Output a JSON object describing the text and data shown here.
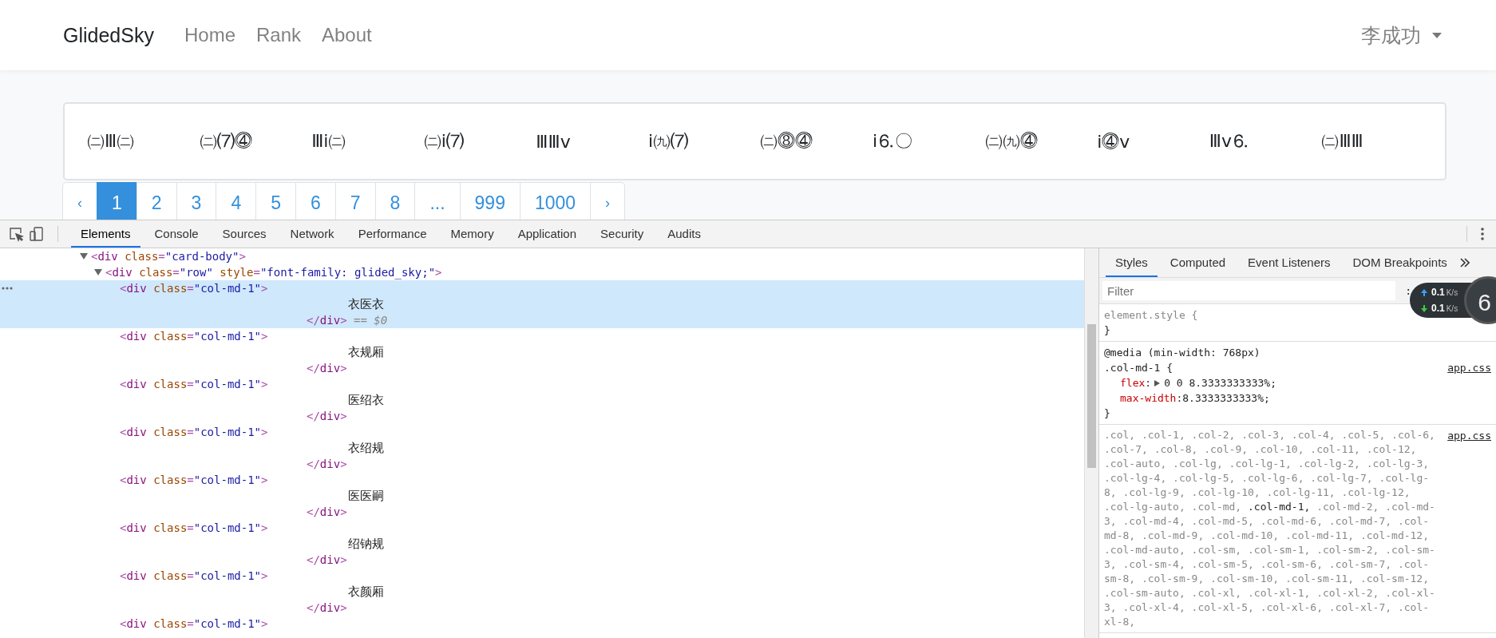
{
  "navbar": {
    "brand": "GlidedSky",
    "links": [
      {
        "label": "Home"
      },
      {
        "label": "Rank"
      },
      {
        "label": "About"
      }
    ],
    "user": "李成功"
  },
  "card": {
    "items": [
      "㈡Ⅲ㈡",
      "㈡⑺⓸",
      "Ⅲⅰ㈡",
      "㈡ⅰ⑺",
      "ⅢⅢⅴ",
      "ⅰ㈨⑺",
      "㈡⓼⓸",
      "ⅰ⒍〇",
      "㈡㈨⓸",
      "ⅰ⓸ⅴ",
      "Ⅲⅴ⒍",
      "㈡ⅢⅢ"
    ]
  },
  "pagination": [
    {
      "label": "‹",
      "selected": false
    },
    {
      "label": "1",
      "selected": true
    },
    {
      "label": "2",
      "selected": false
    },
    {
      "label": "3",
      "selected": false
    },
    {
      "label": "4",
      "selected": false
    },
    {
      "label": "5",
      "selected": false
    },
    {
      "label": "6",
      "selected": false
    },
    {
      "label": "7",
      "selected": false
    },
    {
      "label": "8",
      "selected": false
    },
    {
      "label": "...",
      "selected": false
    },
    {
      "label": "999",
      "selected": false
    },
    {
      "label": "1000",
      "selected": false
    },
    {
      "label": "›",
      "selected": false
    }
  ],
  "devtools": {
    "tabs": [
      {
        "label": "Elements",
        "selected": true
      },
      {
        "label": "Console",
        "selected": false
      },
      {
        "label": "Sources",
        "selected": false
      },
      {
        "label": "Network",
        "selected": false
      },
      {
        "label": "Performance",
        "selected": false
      },
      {
        "label": "Memory",
        "selected": false
      },
      {
        "label": "Application",
        "selected": false
      },
      {
        "label": "Security",
        "selected": false
      },
      {
        "label": "Audits",
        "selected": false
      }
    ],
    "dom_tree": [
      {
        "open": [
          {
            "kind": "punct",
            "text": "<"
          },
          {
            "kind": "tag",
            "text": "div"
          },
          {
            "kind": "attr",
            "text": " class"
          },
          {
            "kind": "punct",
            "text": "="
          },
          {
            "kind": "value",
            "text": "\"card-body\""
          },
          {
            "kind": "punct",
            "text": ">"
          }
        ],
        "expanded": true,
        "selected": false,
        "children": [
          {
            "open": [
              {
                "kind": "punct",
                "text": "<"
              },
              {
                "kind": "tag",
                "text": "div"
              },
              {
                "kind": "attr",
                "text": " class"
              },
              {
                "kind": "punct",
                "text": "="
              },
              {
                "kind": "value",
                "text": "\"row\""
              },
              {
                "kind": "attr",
                "text": " style"
              },
              {
                "kind": "punct",
                "text": "="
              },
              {
                "kind": "value",
                "text": "\"font-family: glided_sky;\""
              },
              {
                "kind": "punct",
                "text": ">"
              }
            ],
            "expanded": true,
            "selected": false,
            "children": [
              {
                "open": [
                  {
                    "kind": "punct",
                    "text": "<"
                  },
                  {
                    "kind": "tag",
                    "text": "div"
                  },
                  {
                    "kind": "attr",
                    "text": " class"
                  },
                  {
                    "kind": "punct",
                    "text": "="
                  },
                  {
                    "kind": "value",
                    "text": "\"col-md-1\""
                  },
                  {
                    "kind": "punct",
                    "text": ">"
                  }
                ],
                "text": "衣医衣",
                "close": [
                  {
                    "kind": "punct",
                    "text": "</"
                  },
                  {
                    "kind": "tag",
                    "text": "div"
                  },
                  {
                    "kind": "punct",
                    "text": ">"
                  },
                  {
                    "kind": "note",
                    "text": " == $0"
                  }
                ],
                "selected": true
              },
              {
                "open": [
                  {
                    "kind": "punct",
                    "text": "<"
                  },
                  {
                    "kind": "tag",
                    "text": "div"
                  },
                  {
                    "kind": "attr",
                    "text": " class"
                  },
                  {
                    "kind": "punct",
                    "text": "="
                  },
                  {
                    "kind": "value",
                    "text": "\"col-md-1\""
                  },
                  {
                    "kind": "punct",
                    "text": ">"
                  }
                ],
                "text": "衣规厢",
                "close": [
                  {
                    "kind": "punct",
                    "text": "</"
                  },
                  {
                    "kind": "tag",
                    "text": "div"
                  },
                  {
                    "kind": "punct",
                    "text": ">"
                  }
                ],
                "selected": false
              },
              {
                "open": [
                  {
                    "kind": "punct",
                    "text": "<"
                  },
                  {
                    "kind": "tag",
                    "text": "div"
                  },
                  {
                    "kind": "attr",
                    "text": " class"
                  },
                  {
                    "kind": "punct",
                    "text": "="
                  },
                  {
                    "kind": "value",
                    "text": "\"col-md-1\""
                  },
                  {
                    "kind": "punct",
                    "text": ">"
                  }
                ],
                "text": "医绍衣",
                "close": [
                  {
                    "kind": "punct",
                    "text": "</"
                  },
                  {
                    "kind": "tag",
                    "text": "div"
                  },
                  {
                    "kind": "punct",
                    "text": ">"
                  }
                ],
                "selected": false
              },
              {
                "open": [
                  {
                    "kind": "punct",
                    "text": "<"
                  },
                  {
                    "kind": "tag",
                    "text": "div"
                  },
                  {
                    "kind": "attr",
                    "text": " class"
                  },
                  {
                    "kind": "punct",
                    "text": "="
                  },
                  {
                    "kind": "value",
                    "text": "\"col-md-1\""
                  },
                  {
                    "kind": "punct",
                    "text": ">"
                  }
                ],
                "text": "衣绍规",
                "close": [
                  {
                    "kind": "punct",
                    "text": "</"
                  },
                  {
                    "kind": "tag",
                    "text": "div"
                  },
                  {
                    "kind": "punct",
                    "text": ">"
                  }
                ],
                "selected": false
              },
              {
                "open": [
                  {
                    "kind": "punct",
                    "text": "<"
                  },
                  {
                    "kind": "tag",
                    "text": "div"
                  },
                  {
                    "kind": "attr",
                    "text": " class"
                  },
                  {
                    "kind": "punct",
                    "text": "="
                  },
                  {
                    "kind": "value",
                    "text": "\"col-md-1\""
                  },
                  {
                    "kind": "punct",
                    "text": ">"
                  }
                ],
                "text": "医医嗣",
                "close": [
                  {
                    "kind": "punct",
                    "text": "</"
                  },
                  {
                    "kind": "tag",
                    "text": "div"
                  },
                  {
                    "kind": "punct",
                    "text": ">"
                  }
                ],
                "selected": false
              },
              {
                "open": [
                  {
                    "kind": "punct",
                    "text": "<"
                  },
                  {
                    "kind": "tag",
                    "text": "div"
                  },
                  {
                    "kind": "attr",
                    "text": " class"
                  },
                  {
                    "kind": "punct",
                    "text": "="
                  },
                  {
                    "kind": "value",
                    "text": "\"col-md-1\""
                  },
                  {
                    "kind": "punct",
                    "text": ">"
                  }
                ],
                "text": "绍钠规",
                "close": [
                  {
                    "kind": "punct",
                    "text": "</"
                  },
                  {
                    "kind": "tag",
                    "text": "div"
                  },
                  {
                    "kind": "punct",
                    "text": ">"
                  }
                ],
                "selected": false
              },
              {
                "open": [
                  {
                    "kind": "punct",
                    "text": "<"
                  },
                  {
                    "kind": "tag",
                    "text": "div"
                  },
                  {
                    "kind": "attr",
                    "text": " class"
                  },
                  {
                    "kind": "punct",
                    "text": "="
                  },
                  {
                    "kind": "value",
                    "text": "\"col-md-1\""
                  },
                  {
                    "kind": "punct",
                    "text": ">"
                  }
                ],
                "text": "衣颜厢",
                "close": [
                  {
                    "kind": "punct",
                    "text": "</"
                  },
                  {
                    "kind": "tag",
                    "text": "div"
                  },
                  {
                    "kind": "punct",
                    "text": ">"
                  }
                ],
                "selected": false
              },
              {
                "open": [
                  {
                    "kind": "punct",
                    "text": "<"
                  },
                  {
                    "kind": "tag",
                    "text": "div"
                  },
                  {
                    "kind": "attr",
                    "text": " class"
                  },
                  {
                    "kind": "punct",
                    "text": "="
                  },
                  {
                    "kind": "value",
                    "text": "\"col-md-1\""
                  },
                  {
                    "kind": "punct",
                    "text": ">"
                  }
                ],
                "selected": false
              }
            ]
          }
        ]
      }
    ],
    "sidebar": {
      "tabs": [
        {
          "label": "Styles",
          "selected": true
        },
        {
          "label": "Computed",
          "selected": false
        },
        {
          "label": "Event Listeners",
          "selected": false
        },
        {
          "label": "DOM Breakpoints",
          "selected": false
        }
      ],
      "filter": {
        "placeholder": "Filter"
      },
      "filter_hint": ":",
      "rules": [
        {
          "selector": "element.style {",
          "close": "}"
        },
        {
          "media": "@media (min-width: 768px)",
          "selector": ".col-md-1 {",
          "source": "app.css",
          "declarations": [
            {
              "property": "flex",
              "separator": ":",
              "value": "0 0 8.3333333333%;",
              "expandable": true
            },
            {
              "property": "max-width",
              "separator": ":",
              "value": "8.3333333333%;",
              "expandable": false
            }
          ],
          "close": "}"
        },
        {
          "source": "app.css",
          "selectors": [
            {
              "text": ".col,",
              "matched": false
            },
            {
              "text": ".col-1,",
              "matched": false
            },
            {
              "text": ".col-2,",
              "matched": false
            },
            {
              "text": ".col-3,",
              "matched": false
            },
            {
              "text": ".col-4,",
              "matched": false
            },
            {
              "text": ".col-5,",
              "matched": false
            },
            {
              "text": ".col-6,",
              "matched": false
            },
            {
              "text": ".col-7,",
              "matched": false
            },
            {
              "text": ".col-8,",
              "matched": false
            },
            {
              "text": ".col-9,",
              "matched": false
            },
            {
              "text": ".col-10,",
              "matched": false
            },
            {
              "text": ".col-11,",
              "matched": false
            },
            {
              "text": ".col-12,",
              "matched": false
            },
            {
              "text": ".col-auto,",
              "matched": false
            },
            {
              "text": ".col-lg,",
              "matched": false
            },
            {
              "text": ".col-lg-1,",
              "matched": false
            },
            {
              "text": ".col-lg-2,",
              "matched": false
            },
            {
              "text": ".col-lg-3,",
              "matched": false
            },
            {
              "text": ".col-lg-4,",
              "matched": false
            },
            {
              "text": ".col-lg-5,",
              "matched": false
            },
            {
              "text": ".col-lg-6,",
              "matched": false
            },
            {
              "text": ".col-lg-7,",
              "matched": false
            },
            {
              "text": ".col-lg-8,",
              "matched": false
            },
            {
              "text": ".col-lg-9,",
              "matched": false
            },
            {
              "text": ".col-lg-10,",
              "matched": false
            },
            {
              "text": ".col-lg-11,",
              "matched": false
            },
            {
              "text": ".col-lg-12,",
              "matched": false
            },
            {
              "text": ".col-lg-auto,",
              "matched": false
            },
            {
              "text": ".col-md,",
              "matched": false
            },
            {
              "text": ".col-md-1,",
              "matched": true
            },
            {
              "text": ".col-md-2,",
              "matched": false
            },
            {
              "text": ".col-md-3,",
              "matched": false
            },
            {
              "text": ".col-md-4,",
              "matched": false
            },
            {
              "text": ".col-md-5,",
              "matched": false
            },
            {
              "text": ".col-md-6,",
              "matched": false
            },
            {
              "text": ".col-md-7,",
              "matched": false
            },
            {
              "text": ".col-md-8,",
              "matched": false
            },
            {
              "text": ".col-md-9,",
              "matched": false
            },
            {
              "text": ".col-md-10,",
              "matched": false
            },
            {
              "text": ".col-md-11,",
              "matched": false
            },
            {
              "text": ".col-md-12,",
              "matched": false
            },
            {
              "text": ".col-md-auto,",
              "matched": false
            },
            {
              "text": ".col-sm,",
              "matched": false
            },
            {
              "text": ".col-sm-1,",
              "matched": false
            },
            {
              "text": ".col-sm-2,",
              "matched": false
            },
            {
              "text": ".col-sm-3,",
              "matched": false
            },
            {
              "text": ".col-sm-4,",
              "matched": false
            },
            {
              "text": ".col-sm-5,",
              "matched": false
            },
            {
              "text": ".col-sm-6,",
              "matched": false
            },
            {
              "text": ".col-sm-7,",
              "matched": false
            },
            {
              "text": ".col-sm-8,",
              "matched": false
            },
            {
              "text": ".col-sm-9,",
              "matched": false
            },
            {
              "text": ".col-sm-10,",
              "matched": false
            },
            {
              "text": ".col-sm-11,",
              "matched": false
            },
            {
              "text": ".col-sm-12,",
              "matched": false
            },
            {
              "text": ".col-sm-auto,",
              "matched": false
            },
            {
              "text": ".col-xl,",
              "matched": false
            },
            {
              "text": ".col-xl-1,",
              "matched": false
            },
            {
              "text": ".col-xl-2,",
              "matched": false
            },
            {
              "text": ".col-xl-3,",
              "matched": false
            },
            {
              "text": ".col-xl-4,",
              "matched": false
            },
            {
              "text": ".col-xl-5,",
              "matched": false
            },
            {
              "text": ".col-xl-6,",
              "matched": false
            },
            {
              "text": ".col-xl-7,",
              "matched": false
            },
            {
              "text": ".col-xl-8,",
              "matched": false
            }
          ]
        }
      ]
    }
  },
  "network_widget": {
    "upload": {
      "value": "0.1",
      "unit": "K/s"
    },
    "download": {
      "value": "0.1",
      "unit": "K/s"
    },
    "badge": "6"
  }
}
